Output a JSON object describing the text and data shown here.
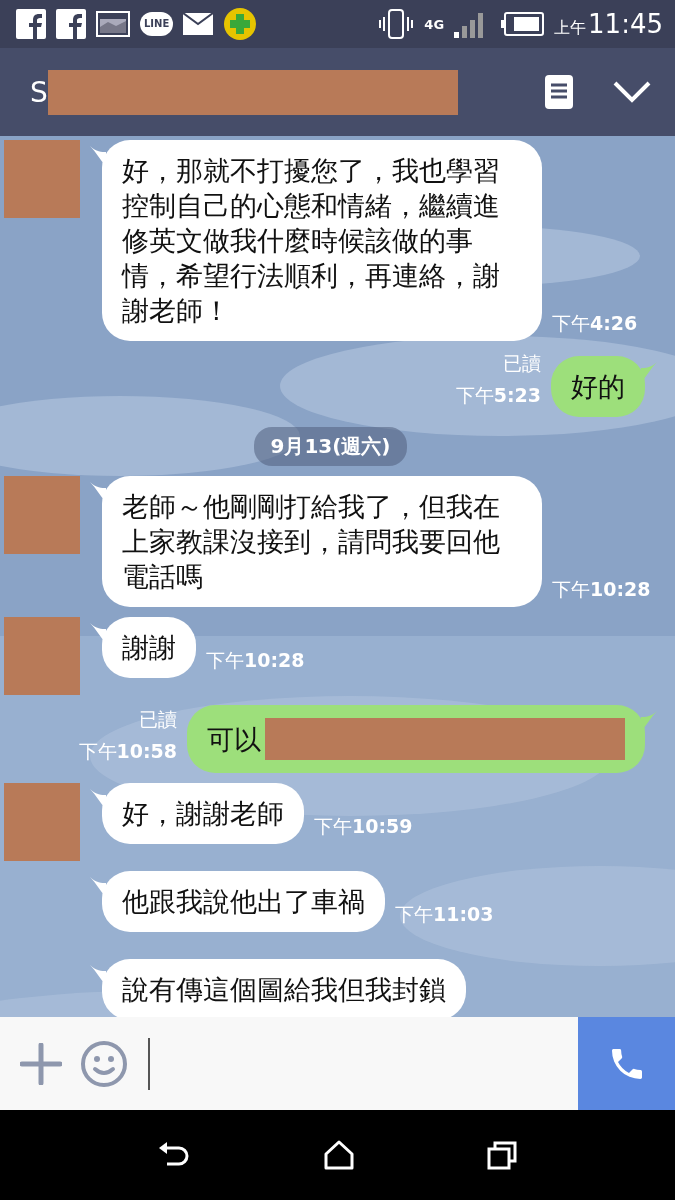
{
  "status_bar": {
    "app_badge_label": "LINE",
    "network": "4G",
    "time_prefix": "上午",
    "time": "11:45"
  },
  "header": {
    "title": "S",
    "title_redacted": true
  },
  "messages": [
    {
      "kind": "incoming",
      "avatar": true,
      "text": "好，那就不打擾您了，我也學習控制自己的心態和情緒，繼續進修英文做我什麼時候該做的事情，希望行法順利，再連絡，謝謝老師！",
      "time_prefix": "下午",
      "time": "4:26"
    },
    {
      "kind": "outgoing",
      "read_label": "已讀",
      "text": "好的",
      "redacted": false,
      "time_prefix": "下午",
      "time": "5:23"
    },
    {
      "kind": "date",
      "text": "9月13(週六)"
    },
    {
      "kind": "incoming",
      "avatar": true,
      "text": "老師～他剛剛打給我了，但我在上家教課沒接到，請問我要回他電話嗎",
      "time_prefix": "下午",
      "time": "10:28"
    },
    {
      "kind": "incoming",
      "avatar": true,
      "text": "謝謝",
      "time_prefix": "下午",
      "time": "10:28"
    },
    {
      "kind": "outgoing",
      "read_label": "已讀",
      "text": "可以",
      "redacted": true,
      "time_prefix": "下午",
      "time": "10:58"
    },
    {
      "kind": "incoming",
      "avatar": true,
      "text": "好，謝謝老師",
      "time_prefix": "下午",
      "time": "10:59"
    },
    {
      "kind": "incoming",
      "avatar": false,
      "text": "他跟我說他出了車禍",
      "time_prefix": "下午",
      "time": "11:03"
    },
    {
      "kind": "incoming",
      "avatar": false,
      "text": "說有傳這個圖給我但我封鎖"
    }
  ]
}
